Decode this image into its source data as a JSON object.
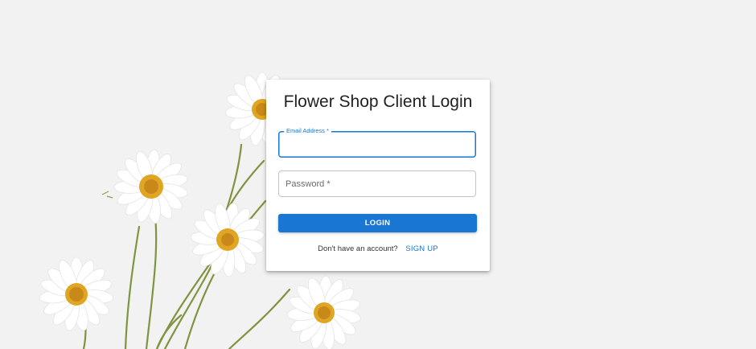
{
  "page": {
    "title": "Flower Shop Client Login"
  },
  "form": {
    "email_label": "Email Address *",
    "email_value": "",
    "password_placeholder": "Password *",
    "password_value": "",
    "login_label": "LOGIN",
    "signup_prompt": "Don't have an account?",
    "signup_link": "SIGN UP"
  },
  "colors": {
    "accent": "#1976d2",
    "background": "#f2f2f2"
  },
  "background_image": {
    "subject": "white-daisies-icon"
  }
}
